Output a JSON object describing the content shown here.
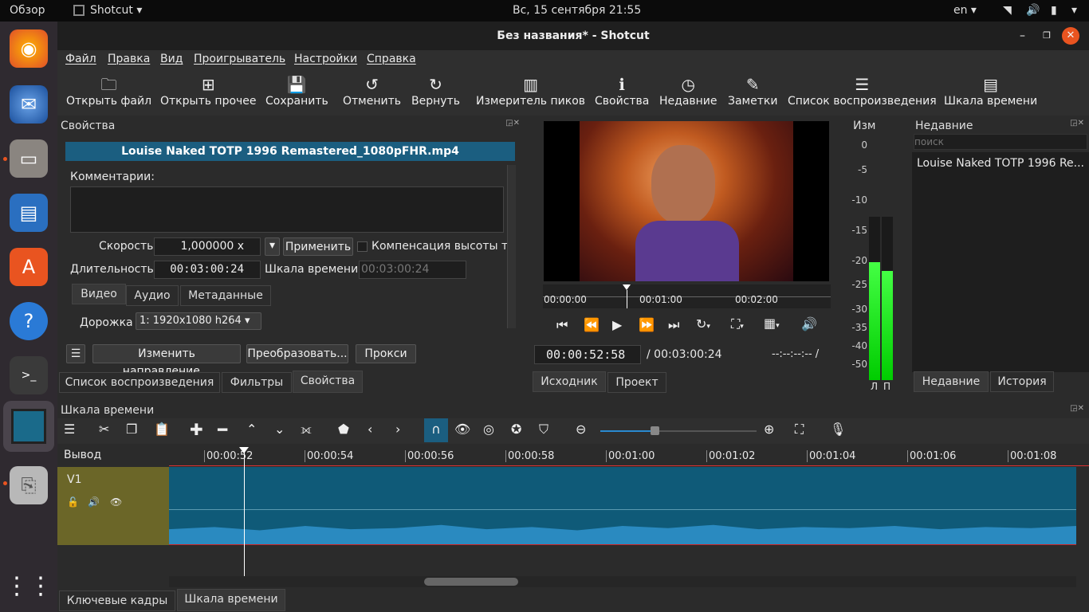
{
  "topbar": {
    "activities": "Обзор",
    "app": "Shotcut ▾",
    "datetime": "Вс, 15 сентября  21:55",
    "lang": "en ▾"
  },
  "window": {
    "title": "Без названия* - Shotcut"
  },
  "menu": [
    "Файл",
    "Правка",
    "Вид",
    "Проигрыватель",
    "Настройки",
    "Справка"
  ],
  "toolbar": {
    "open_file": "Открыть файл",
    "open_other": "Открыть прочее",
    "save": "Сохранить",
    "undo": "Отменить",
    "redo": "Вернуть",
    "peak_meter": "Измеритель пиков",
    "properties": "Свойства",
    "recent": "Недавние",
    "notes": "Заметки",
    "playlist": "Список воспроизведения",
    "timeline": "Шкала времени"
  },
  "properties": {
    "title": "Свойства",
    "clip_name": "Louise Naked TOTP 1996 Remastered_1080pFHR.mp4",
    "comments_label": "Комментарии:",
    "speed_label": "Скорость",
    "speed_value": "1,000000 x",
    "apply": "Применить",
    "pitch_comp": "Компенсация высоты то",
    "duration_label": "Длительность",
    "duration_value": "00:03:00:24",
    "timeline_label": "Шкала времени",
    "timeline_value": "00:03:00:24",
    "tabs": [
      "Видео",
      "Аудио",
      "Метаданные"
    ],
    "track_label": "Дорожка",
    "track_value": "1: 1920x1080 h264",
    "reverse": "Изменить направление...",
    "convert": "Преобразовать...",
    "proxy": "Прокси"
  },
  "left_tabs": [
    "Список воспроизведения",
    "Фильтры",
    "Свойства"
  ],
  "player": {
    "ruler": [
      "00:00:00",
      "00:01:00",
      "00:02:00"
    ],
    "current": "00:00:52:58",
    "total": "/ 00:03:00:24",
    "inpoint": "--:--:--:-- /",
    "tabs": [
      "Исходник",
      "Проект"
    ]
  },
  "meter": {
    "title": "Изм",
    "scale": [
      "0",
      "-5",
      "-10",
      "-15",
      "-20",
      "-25",
      "-30",
      "-35",
      "-40",
      "-50"
    ],
    "left": "Л",
    "right": "П",
    "level_l": 0.72,
    "level_r": 0.67
  },
  "recent": {
    "title": "Недавние",
    "search_placeholder": "поиск",
    "items": [
      "Louise Naked TOTP 1996 Re..."
    ],
    "tabs": [
      "Недавние",
      "История"
    ]
  },
  "timeline": {
    "title": "Шкала времени",
    "output": "Вывод",
    "track": "V1",
    "ticks": [
      "00:00:52",
      "00:00:54",
      "00:00:56",
      "00:00:58",
      "00:01:00",
      "00:01:02",
      "00:01:04",
      "00:01:06",
      "00:01:08"
    ]
  },
  "bottom_tabs": [
    "Ключевые кадры",
    "Шкала времени"
  ]
}
